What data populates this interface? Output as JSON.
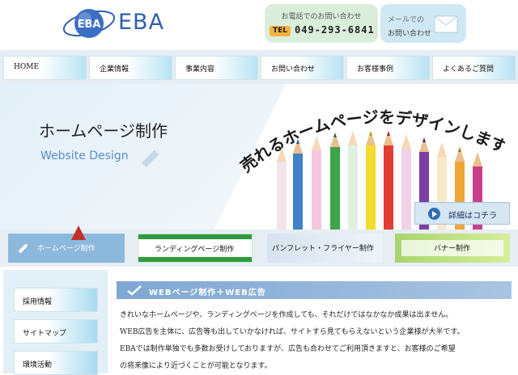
{
  "header": {
    "logo_text": "EBA",
    "logo_badge": "EBA",
    "tel_label": "お電話でのお問い合わせ",
    "tel_badge": "TEL",
    "tel_number": "049-293-6841",
    "mail_label_1": "メールでの",
    "mail_label_2": "お問い合わせ"
  },
  "nav": {
    "items": [
      {
        "label": "HOME"
      },
      {
        "label": "企業情報"
      },
      {
        "label": "事業内容"
      },
      {
        "label": "お問い合わせ"
      },
      {
        "label": "お客様事例"
      },
      {
        "label": "よくあるご質問"
      }
    ]
  },
  "hero": {
    "title": "ホームページ制作",
    "subtitle": "Website Design",
    "slogan": "売れるホームページをデザインします",
    "detail_button": "詳細はコチラ"
  },
  "services": [
    {
      "label": "ホームページ制作"
    },
    {
      "label": "ランディングページ制作"
    },
    {
      "label": "パンフレット・フライヤー制作"
    },
    {
      "label": "バナー制作"
    }
  ],
  "sidebar": {
    "items": [
      {
        "label": "採用情報"
      },
      {
        "label": "サイトマップ"
      },
      {
        "label": "環境活動"
      }
    ]
  },
  "main": {
    "section_title": "WEBページ制作＋WEB広告",
    "paragraphs": [
      "きれいなホームページや、ランディングページを作成しても、それだけではなかなか成果は出ません。",
      "WEB広告を主体に、広告等も出していかなければ、サイトすら見てもらえないという企業様が大半です。",
      "EBAでは制作単独でも多数お受けしておりますが、広告も合わせてご利用頂きますと、お客様のご希望",
      "の将来像により近づくことが可能となります。"
    ]
  },
  "colors": {
    "brand_blue": "#2f5fb0",
    "tel_bg": "#dbeedc",
    "mail_bg": "#cfe8f3",
    "section_bar": "#7ea7d3",
    "arrow_red": "#c0302b"
  }
}
